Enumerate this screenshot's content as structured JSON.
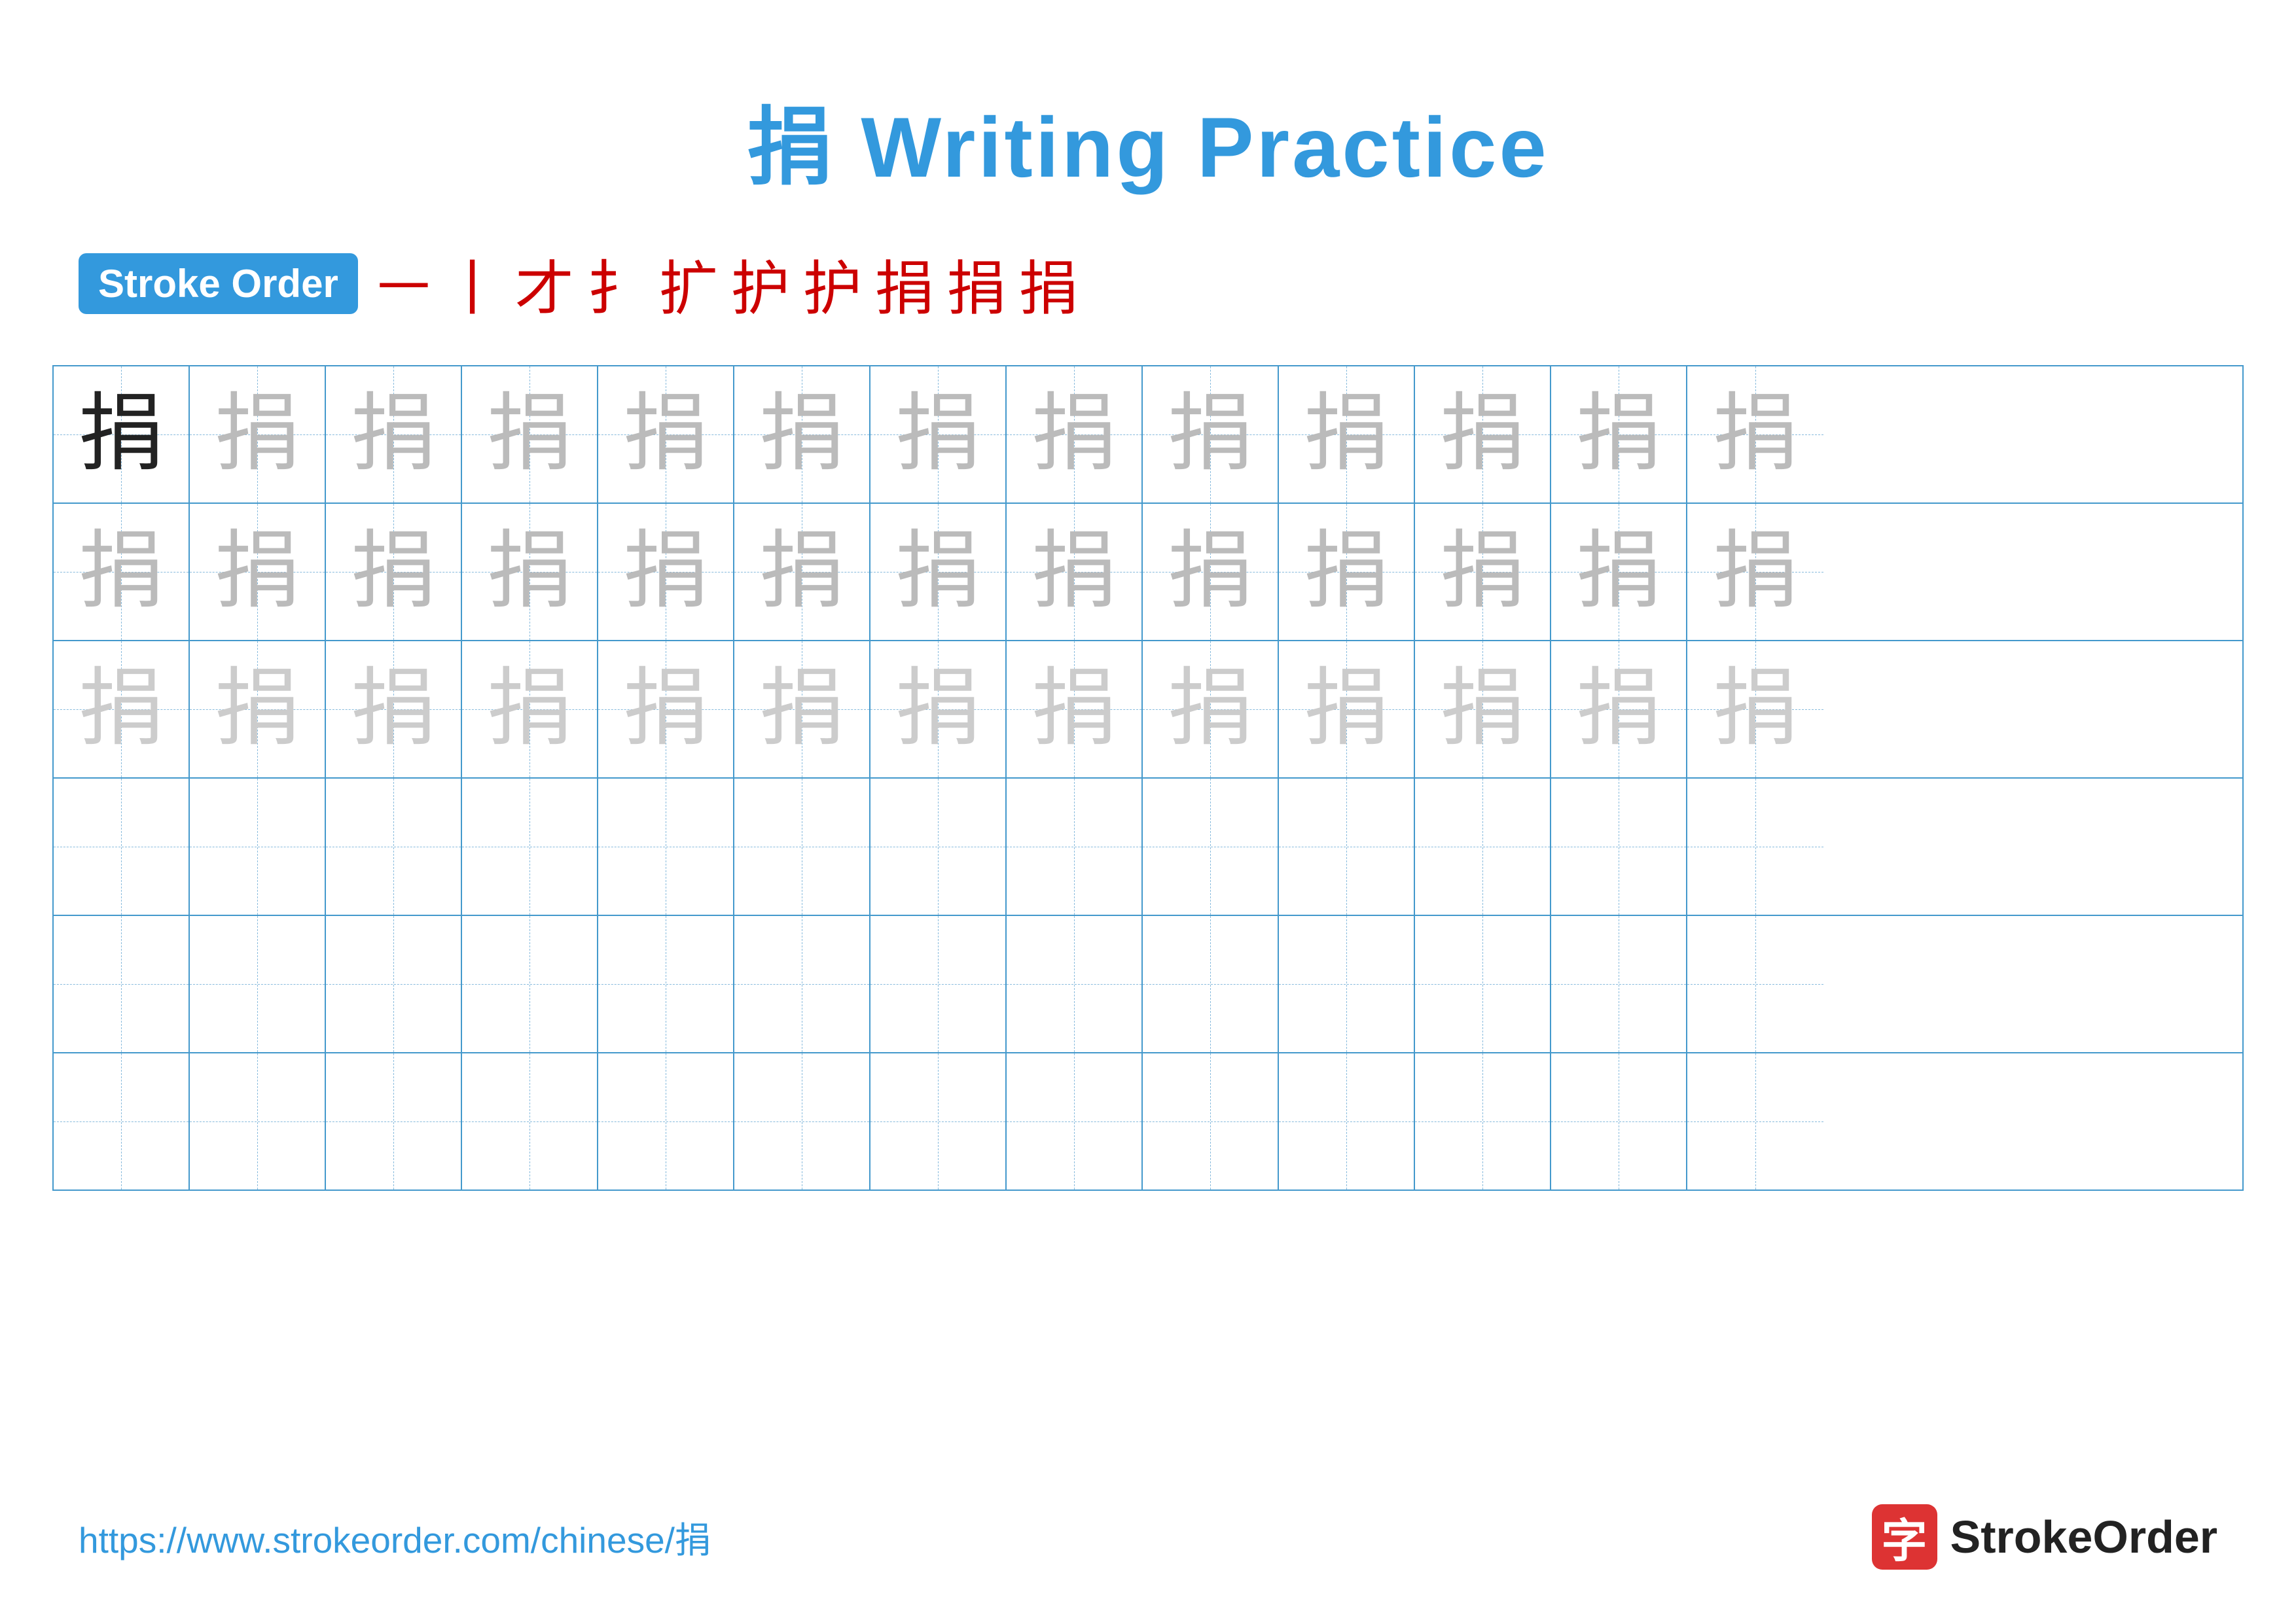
{
  "title": "捐 Writing Practice",
  "stroke_order": {
    "badge_label": "Stroke Order",
    "strokes": [
      "一",
      "丨",
      "才",
      "扌",
      "扩",
      "护",
      "护",
      "捐",
      "捐",
      "捐"
    ]
  },
  "character": "捐",
  "grid": {
    "rows": 6,
    "cols": 13,
    "row_types": [
      "dark-guide",
      "medium-guide",
      "light-guide",
      "empty",
      "empty",
      "empty"
    ]
  },
  "footer": {
    "url": "https://www.strokeorder.com/chinese/捐",
    "logo_char": "字",
    "logo_text": "StrokeOrder"
  }
}
